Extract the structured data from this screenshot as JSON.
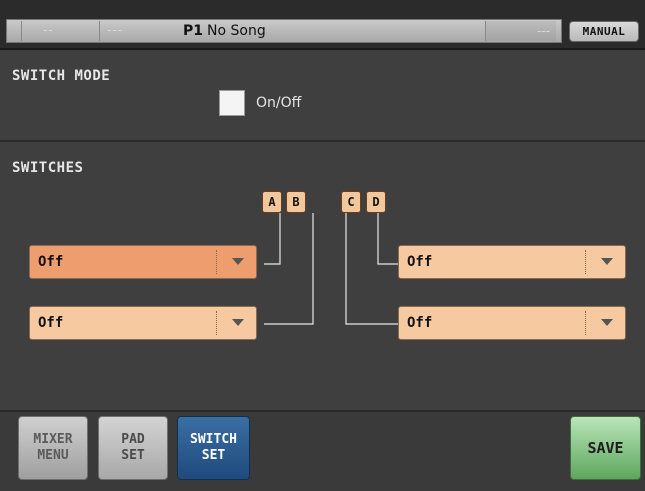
{
  "topbar": {
    "seg_a": "--",
    "seg_b": "---",
    "song_number": "P1",
    "song_name": "No Song",
    "seg_right": "---",
    "manual_label": "MANUAL"
  },
  "switch_mode": {
    "title": "SWITCH MODE",
    "checkbox_label": "On/Off",
    "checked": false
  },
  "switches": {
    "title": "SWITCHES",
    "badges": [
      "A",
      "B",
      "C",
      "D"
    ],
    "dropdowns": {
      "a": "Off",
      "b": "Off",
      "c": "Off",
      "d": "Off"
    }
  },
  "bottom": {
    "mixer_line1": "MIXER",
    "mixer_line2": "MENU",
    "pad_line1": "PAD",
    "pad_line2": "SET",
    "switch_line1": "SWITCH",
    "switch_line2": "SET",
    "save_label": "SAVE"
  },
  "colors": {
    "dropdown": "#f6c9a1",
    "dropdown_active": "#ee9e6e",
    "active_tab": "#1f4a7c",
    "save": "#5ea65e"
  }
}
